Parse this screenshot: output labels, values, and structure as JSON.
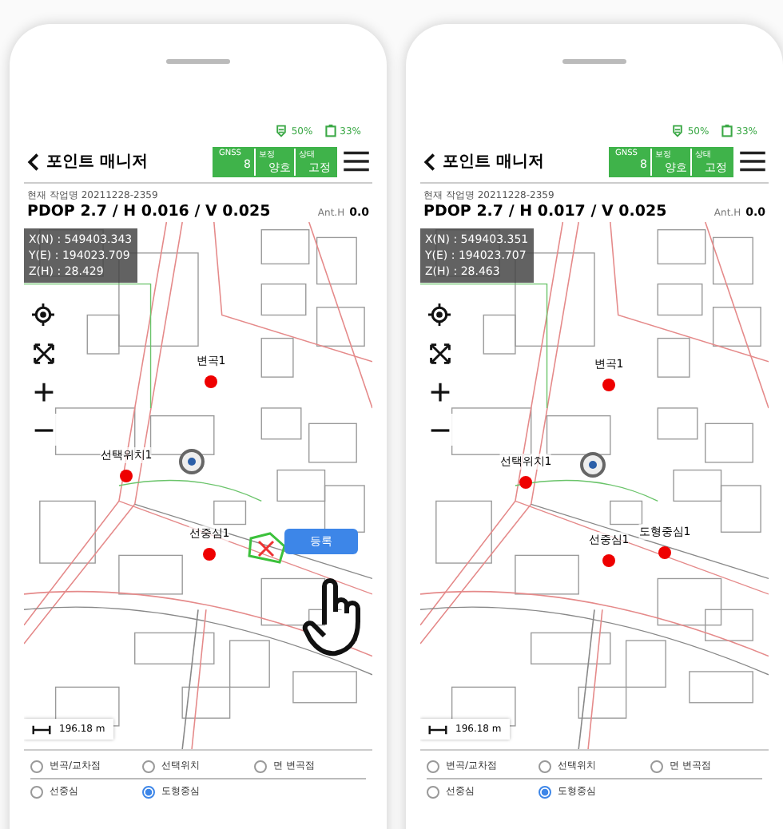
{
  "phones": [
    {
      "status": {
        "signal": "50%",
        "battery": "33%"
      },
      "title": "포인트 매니저",
      "gnss_badges": [
        {
          "label": "GNSS",
          "value": "8"
        },
        {
          "label": "보정",
          "value": "양호"
        },
        {
          "label": "상태",
          "value": "고정"
        }
      ],
      "work_name": "현재 작업명 20211228-2359",
      "pdop": "PDOP 2.7 / H 0.016 / V 0.025",
      "ant_h_label": "Ant.H",
      "ant_h_value": "0.0",
      "coordinates": [
        "X(N) : 549403.343",
        "Y(E) : 194023.709",
        "Z(H) : 28.429"
      ],
      "markers": [
        {
          "label": "변곡1"
        },
        {
          "label": "선택위치1"
        },
        {
          "label": "선중심1"
        }
      ],
      "register_button": "등록",
      "selected_shape": true,
      "tap_hint": true,
      "scale": "196.18 m",
      "snap_option_rows": [
        {
          "options": [
            {
              "label": "변곡/교차점",
              "selected": false
            },
            {
              "label": "선택위치",
              "selected": false
            },
            {
              "label": "면 변곡점",
              "selected": false
            }
          ]
        },
        {
          "options": [
            {
              "label": "선중심",
              "selected": false
            },
            {
              "label": "도형중심",
              "selected": true
            }
          ]
        }
      ]
    },
    {
      "status": {
        "signal": "50%",
        "battery": "33%"
      },
      "title": "포인트 매니저",
      "gnss_badges": [
        {
          "label": "GNSS",
          "value": "8"
        },
        {
          "label": "보정",
          "value": "양호"
        },
        {
          "label": "상태",
          "value": "고정"
        }
      ],
      "work_name": "현재 작업명 20211228-2359",
      "pdop": "PDOP 2.7 / H 0.017 / V 0.025",
      "ant_h_label": "Ant.H",
      "ant_h_value": "0.0",
      "coordinates": [
        "X(N) : 549403.351",
        "Y(E) : 194023.707",
        "Z(H) : 28.463"
      ],
      "markers": [
        {
          "label": "변곡1"
        },
        {
          "label": "선택위치1"
        },
        {
          "label": "선중심1"
        },
        {
          "label": "도형중심1"
        }
      ],
      "selected_shape": false,
      "tap_hint": false,
      "scale": "196.18 m",
      "snap_option_rows": [
        {
          "options": [
            {
              "label": "변곡/교차점",
              "selected": false
            },
            {
              "label": "선택위치",
              "selected": false
            },
            {
              "label": "면 변곡점",
              "selected": false
            }
          ]
        },
        {
          "options": [
            {
              "label": "선중심",
              "selected": false
            },
            {
              "label": "도형중심",
              "selected": true
            }
          ]
        }
      ]
    }
  ]
}
